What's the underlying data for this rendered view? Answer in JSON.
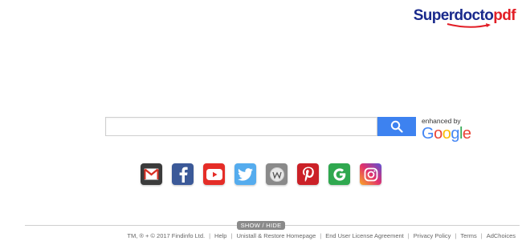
{
  "brand": {
    "part1": "Superdocto",
    "part2": "pdf",
    "color_primary": "#1a2a8c",
    "color_accent": "#e21e26"
  },
  "search": {
    "placeholder": "",
    "value": "",
    "button_icon": "search-icon",
    "button_color": "#3d82f0"
  },
  "enhanced_by": {
    "label": "enhanced by",
    "letters": [
      "G",
      "o",
      "o",
      "g",
      "l",
      "e"
    ]
  },
  "quick_links": [
    {
      "name": "gmail",
      "icon": "gmail-icon",
      "bg": "#3b3b3b"
    },
    {
      "name": "facebook",
      "icon": "facebook-icon",
      "bg": "#3b5998"
    },
    {
      "name": "youtube",
      "icon": "youtube-icon",
      "bg": "#e52d27"
    },
    {
      "name": "twitter",
      "icon": "twitter-icon",
      "bg": "#55acee"
    },
    {
      "name": "wikipedia",
      "icon": "wikipedia-icon",
      "bg": "#8a8a8a"
    },
    {
      "name": "pinterest",
      "icon": "pinterest-icon",
      "bg": "#cb2027"
    },
    {
      "name": "google-plus",
      "icon": "google-g-icon",
      "bg": "#2fa84f"
    },
    {
      "name": "instagram",
      "icon": "instagram-icon",
      "bg": "#c13584"
    }
  ],
  "toggle": {
    "label": "SHOW / HIDE"
  },
  "footer": {
    "copyright": "TM, ® + © 2017 Findinfo Ltd.",
    "links": [
      "Help",
      "Unistall & Restore Homepage",
      "End User License Agreement",
      "Privacy Policy",
      "Terms",
      "AdChoices"
    ]
  }
}
